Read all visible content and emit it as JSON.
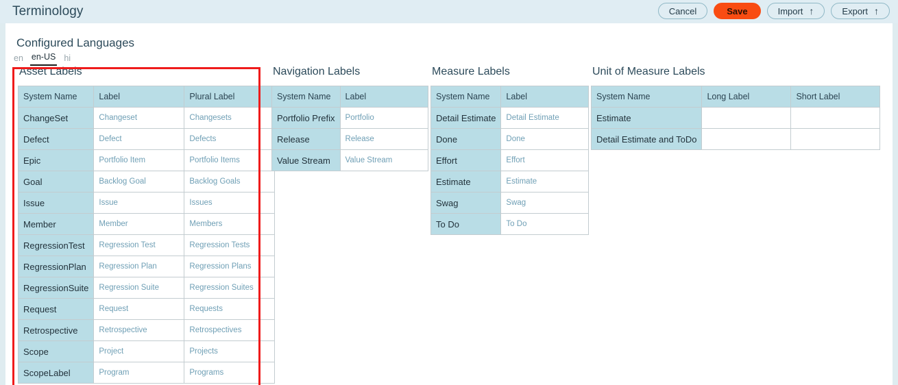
{
  "header": {
    "title": "Terminology",
    "buttons": [
      {
        "id": "cancel",
        "label": "Cancel",
        "style": "outline",
        "icon": null
      },
      {
        "id": "save",
        "label": "Save",
        "style": "primary",
        "icon": null
      },
      {
        "id": "import",
        "label": "Import",
        "style": "outline",
        "icon": "arrow-up-icon"
      },
      {
        "id": "export",
        "label": "Export",
        "style": "outline",
        "icon": "arrow-up-icon"
      }
    ],
    "arrow_glyph": "↑"
  },
  "section": {
    "title": "Configured Languages",
    "languages": [
      {
        "code": "en",
        "active": false
      },
      {
        "code": "en-US",
        "active": true
      },
      {
        "code": "hi",
        "active": false
      }
    ]
  },
  "tables": {
    "asset": {
      "title": "Asset Labels",
      "columns": [
        "System Name",
        "Label",
        "Plural Label"
      ],
      "rows": [
        [
          "ChangeSet",
          "Changeset",
          "Changesets"
        ],
        [
          "Defect",
          "Defect",
          "Defects"
        ],
        [
          "Epic",
          "Portfolio Item",
          "Portfolio Items"
        ],
        [
          "Goal",
          "Backlog Goal",
          "Backlog Goals"
        ],
        [
          "Issue",
          "Issue",
          "Issues"
        ],
        [
          "Member",
          "Member",
          "Members"
        ],
        [
          "RegressionTest",
          "Regression Test",
          "Regression Tests"
        ],
        [
          "RegressionPlan",
          "Regression Plan",
          "Regression Plans"
        ],
        [
          "RegressionSuite",
          "Regression Suite",
          "Regression Suites"
        ],
        [
          "Request",
          "Request",
          "Requests"
        ],
        [
          "Retrospective",
          "Retrospective",
          "Retrospectives"
        ],
        [
          "Scope",
          "Project",
          "Projects"
        ],
        [
          "ScopeLabel",
          "Program",
          "Programs"
        ]
      ]
    },
    "navigation": {
      "title": "Navigation Labels",
      "columns": [
        "System Name",
        "Label"
      ],
      "rows": [
        [
          "Portfolio Prefix",
          "Portfolio"
        ],
        [
          "Release",
          "Release"
        ],
        [
          "Value Stream",
          "Value Stream"
        ]
      ]
    },
    "measure": {
      "title": "Measure Labels",
      "columns": [
        "System Name",
        "Label"
      ],
      "rows": [
        [
          "Detail Estimate",
          "Detail Estimate"
        ],
        [
          "Done",
          "Done"
        ],
        [
          "Effort",
          "Effort"
        ],
        [
          "Estimate",
          "Estimate"
        ],
        [
          "Swag",
          "Swag"
        ],
        [
          "To Do",
          "To Do"
        ]
      ]
    },
    "unit_of_measure": {
      "title": "Unit of Measure Labels",
      "columns": [
        "System Name",
        "Long Label",
        "Short Label"
      ],
      "rows": [
        [
          "Estimate",
          "",
          ""
        ],
        [
          "Detail Estimate and ToDo",
          "",
          ""
        ]
      ]
    }
  },
  "colors": {
    "page_background": "#dfecf0",
    "topbar_background": "#e0edf3",
    "card_background": "#ffffff",
    "table_header": "#b9dde6",
    "system_name_cell": "#b9dde6",
    "value_text": "#6f9fb5",
    "save_button": "#f94c12",
    "highlight_border": "#ef1b1b",
    "title_text": "#2c4a5a"
  }
}
